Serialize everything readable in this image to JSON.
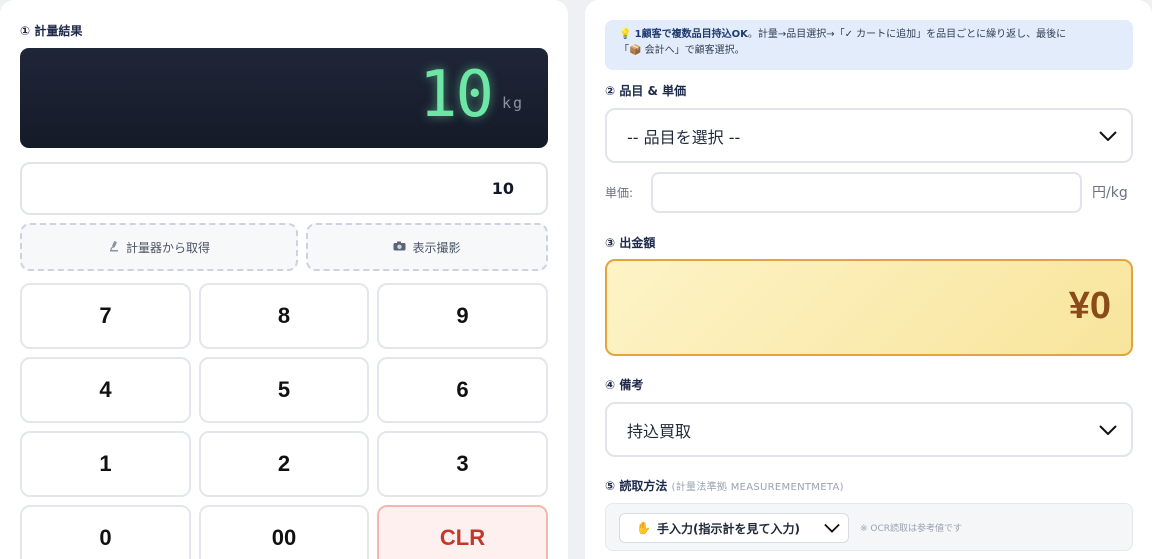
{
  "scale": {
    "section_label": "① 計量結果",
    "display_value": "10",
    "display_unit": "kg",
    "weight_input_value": "10",
    "fetch_button": {
      "icon": "microscope-icon",
      "label": "計量器から取得"
    },
    "photo_button": {
      "icon": "camera-icon",
      "label": "表示撮影"
    }
  },
  "keypad": {
    "keys": [
      "7",
      "8",
      "9",
      "4",
      "5",
      "6",
      "1",
      "2",
      "3",
      "0",
      "00",
      "CLR"
    ]
  },
  "hint": {
    "icon": "lightbulb-icon",
    "bold_text": "1顧客で複数品目持込OK",
    "line1": "。計量→品目選択→「✓ カートに追加」を品目ごとに繰り返し、最後に",
    "line2": "「📦 会計へ」で顧客選択。"
  },
  "item": {
    "section_label": "② 品目 & 単価",
    "select_value": "-- 品目を選択 --",
    "price_label": "単価:",
    "price_value": "",
    "price_unit": "円/kg"
  },
  "amount": {
    "section_label": "③ 出金額",
    "value": "¥0"
  },
  "remarks": {
    "section_label": "④ 備考",
    "select_value": "持込買取"
  },
  "reading": {
    "section_label": "⑤ 読取方法",
    "section_sub": "(計量法準拠 MEASUREMENTMETA)",
    "method_icon": "raised-hand-icon",
    "method_value": "手入力(指示計を見て入力)",
    "note": "※ OCR読取は参考値です"
  },
  "colors": {
    "display_bg": "#1a2030",
    "display_digits": "#6ee7a6",
    "amount_bg": "#f8e59c",
    "amount_border": "#e0a540",
    "amount_text": "#8b4a1a",
    "clr_text": "#c0392b",
    "hint_bg": "#e3ecfb"
  }
}
